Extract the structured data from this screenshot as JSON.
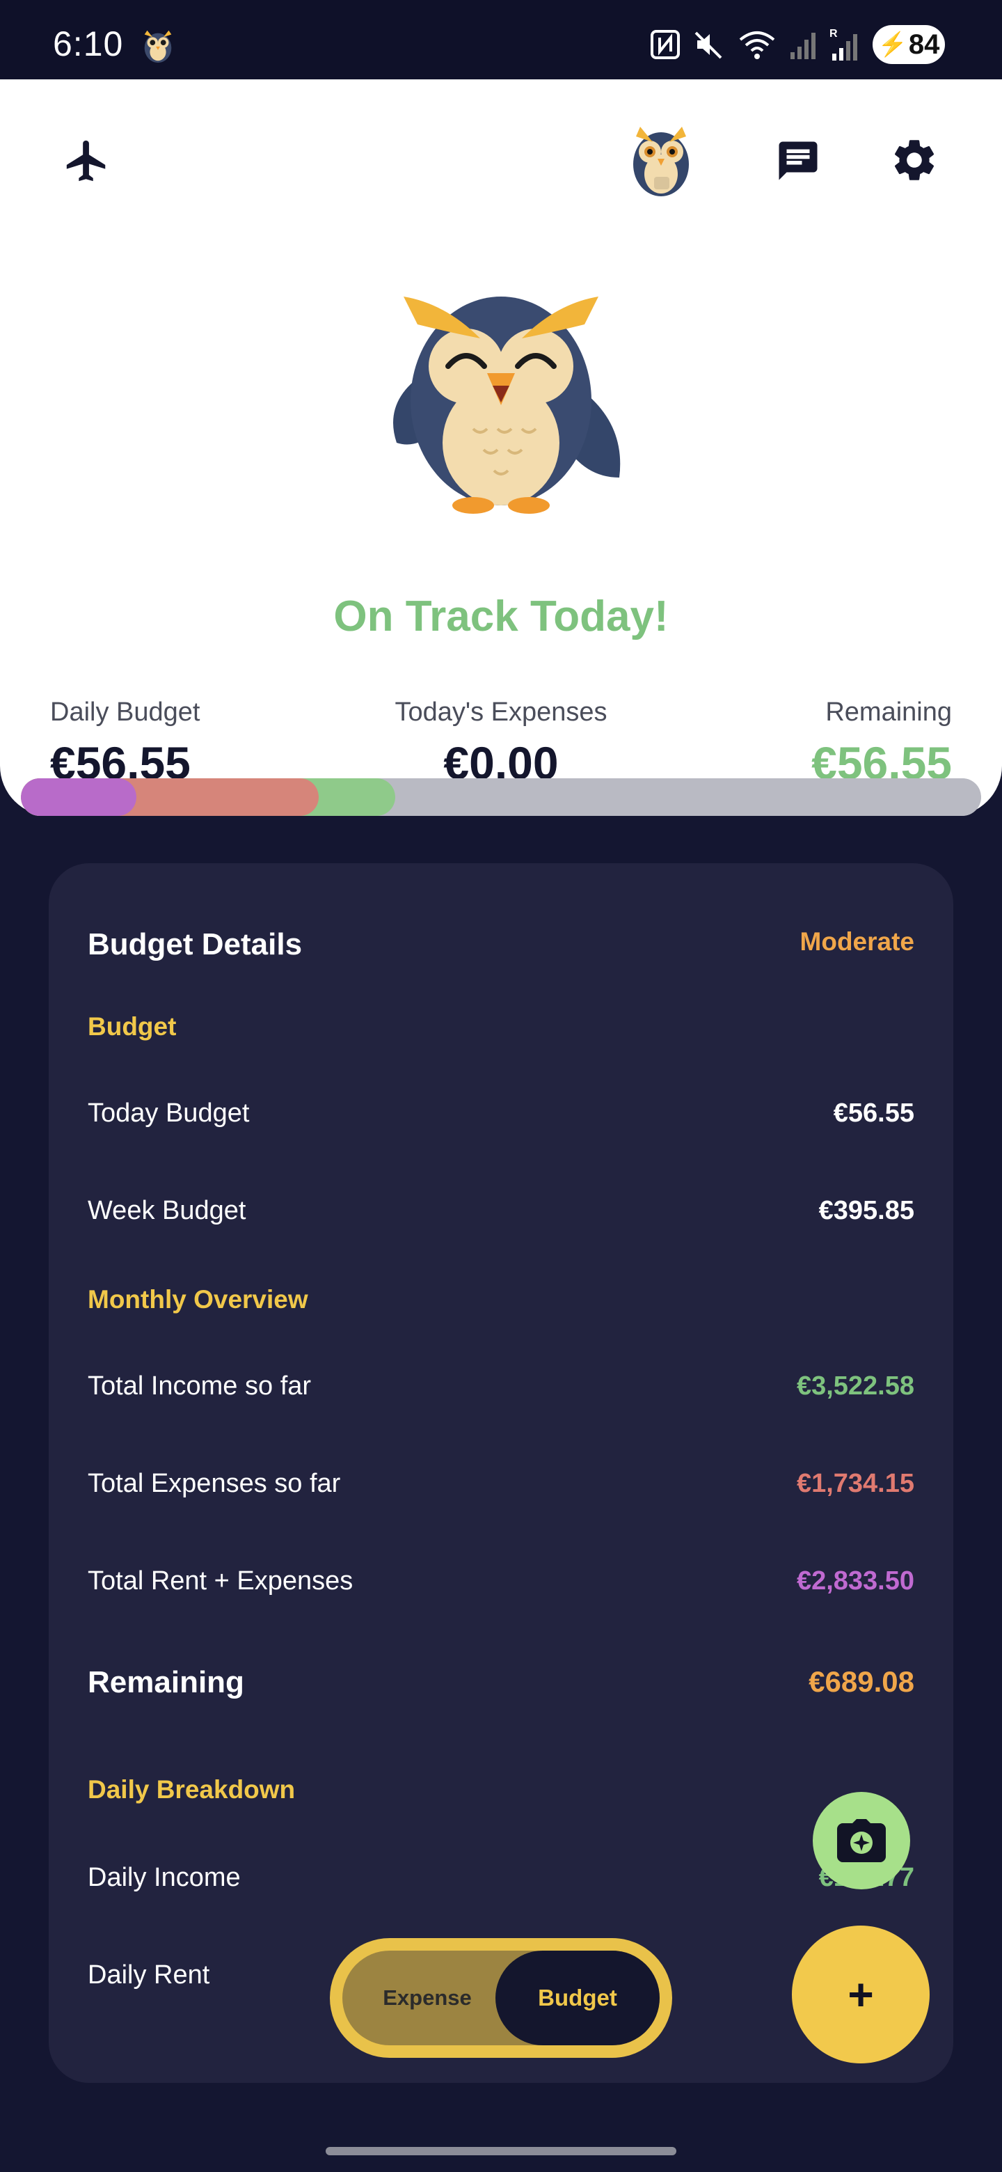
{
  "status_bar": {
    "time": "6:10",
    "battery": "84",
    "icons": [
      "owl-icon",
      "nfc-icon",
      "mute-icon",
      "wifi-icon",
      "cell-signal-icon",
      "cell-signal-r-icon",
      "battery-icon"
    ]
  },
  "header": {
    "left_icon": "airplane-icon",
    "right_icons": [
      "owl-avatar-icon",
      "chat-icon",
      "gear-icon"
    ]
  },
  "hero": {
    "title": "On Track Today!",
    "title_color": "#7ec27e",
    "mascot": "happy-owl-icon"
  },
  "stats": {
    "daily_budget_label": "Daily Budget",
    "daily_budget_value": "€56.55",
    "todays_expenses_label": "Today's Expenses",
    "todays_expenses_value": "€0.00",
    "remaining_label": "Remaining",
    "remaining_value": "€56.55"
  },
  "progress": {
    "segments": [
      {
        "color": "#b86bc9",
        "fraction": 0.12
      },
      {
        "color": "#d6857a",
        "fraction": 0.19
      },
      {
        "color": "#8fca8a",
        "fraction": 0.08
      },
      {
        "color": "#b9bac3",
        "fraction": 0.61
      }
    ]
  },
  "details": {
    "title": "Budget Details",
    "mode": "Moderate",
    "section_budget": "Budget",
    "today_budget_label": "Today Budget",
    "today_budget_value": "€56.55",
    "week_budget_label": "Week Budget",
    "week_budget_value": "€395.85",
    "section_monthly": "Monthly Overview",
    "total_income_label": "Total Income so far",
    "total_income_value": "€3,522.58",
    "total_expenses_label": "Total Expenses so far",
    "total_expenses_value": "€1,734.15",
    "total_rent_label": "Total Rent + Expenses",
    "total_rent_value": "€2,833.50",
    "remaining_label": "Remaining",
    "remaining_value": "€689.08",
    "section_daily": "Daily Breakdown",
    "daily_income_label": "Daily Income",
    "daily_income_value": "€143.77",
    "daily_rent_label": "Daily Rent"
  },
  "colors": {
    "green": "#7ec27e",
    "red": "#e07a70",
    "purple": "#c06ad1",
    "orange": "#f0a64a",
    "yellow": "#f1c84a"
  },
  "toggle": {
    "expense_label": "Expense",
    "budget_label": "Budget",
    "selected": "Budget"
  },
  "fabs": {
    "camera_icon": "camera-icon",
    "add_label": "+"
  }
}
